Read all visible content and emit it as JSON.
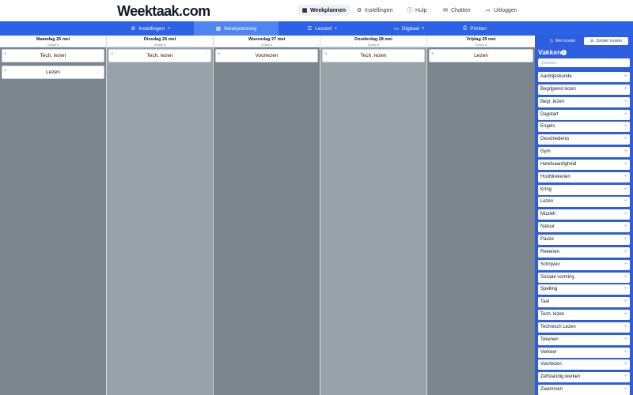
{
  "app": {
    "logo": "Weektaak.com"
  },
  "topnav": {
    "weekplannen": "Weekplannen",
    "instellingen": "Instellingen",
    "hulp": "Hulp",
    "chatten": "Chatten",
    "uitloggen": "Uitloggen"
  },
  "navbar": {
    "instellingen": "Instellingen",
    "weekplanning": "Weekplanning",
    "lesstof": "Lesstof",
    "digitaal": "Digitaal",
    "printen": "Printen"
  },
  "days": [
    {
      "title": "Maandag 25 mei",
      "group": "Groep 6",
      "cards": [
        "Tech. lezen",
        "Lezen"
      ]
    },
    {
      "title": "Dinsdag 26 mei",
      "group": "Groep 6",
      "cards": [
        "Tech. lezen"
      ]
    },
    {
      "title": "Woensdag 27 mei",
      "group": "Groep 6",
      "cards": [
        "Voorlezen"
      ]
    },
    {
      "title": "Donderdag 28 mei",
      "group": "Groep 6",
      "cards": [
        "Tech. lezen"
      ]
    },
    {
      "title": "Vrijdag 29 mei",
      "group": "Groep 6",
      "cards": [
        "Lezen"
      ]
    }
  ],
  "sidebar": {
    "toggle_met": "Met rooster",
    "toggle_zonder": "Zonder rooster",
    "title": "Vakken",
    "search_placeholder": "Zoeken...",
    "subjects": [
      "Aardrijkskunde",
      "Begrijpend lezen",
      "Begr. lezen",
      "Dagstart",
      "Engels",
      "Geschiedenis",
      "Gym",
      "Handvaardigheid",
      "Hoofdrekenen",
      "Kring",
      "Lezen",
      "Muziek",
      "Natuur",
      "Pauze",
      "Rekenen",
      "Schrijven",
      "Sociale vorming",
      "Spelling",
      "Taal",
      "Tech. lezen",
      "Technisch Lezen",
      "Tekenen",
      "Verkeer",
      "Voorlezen",
      "Zelfstandig werken",
      "Zwemmen"
    ]
  },
  "colors": {
    "brand_blue": "#2b62e6",
    "navbar_active": "#4e85f0",
    "sidebar_blue": "#2e5ee0",
    "column_dark": "#7b858d",
    "column_light": "#98a2a9"
  },
  "icons": {
    "weekplannen": "calendar-icon",
    "instellingen": "sliders-icon",
    "hulp": "help-circle-icon",
    "chatten": "chat-icon",
    "uitloggen": "logout-icon",
    "lesstof": "list-icon",
    "digitaal": "monitor-icon",
    "printen": "printer-icon"
  }
}
